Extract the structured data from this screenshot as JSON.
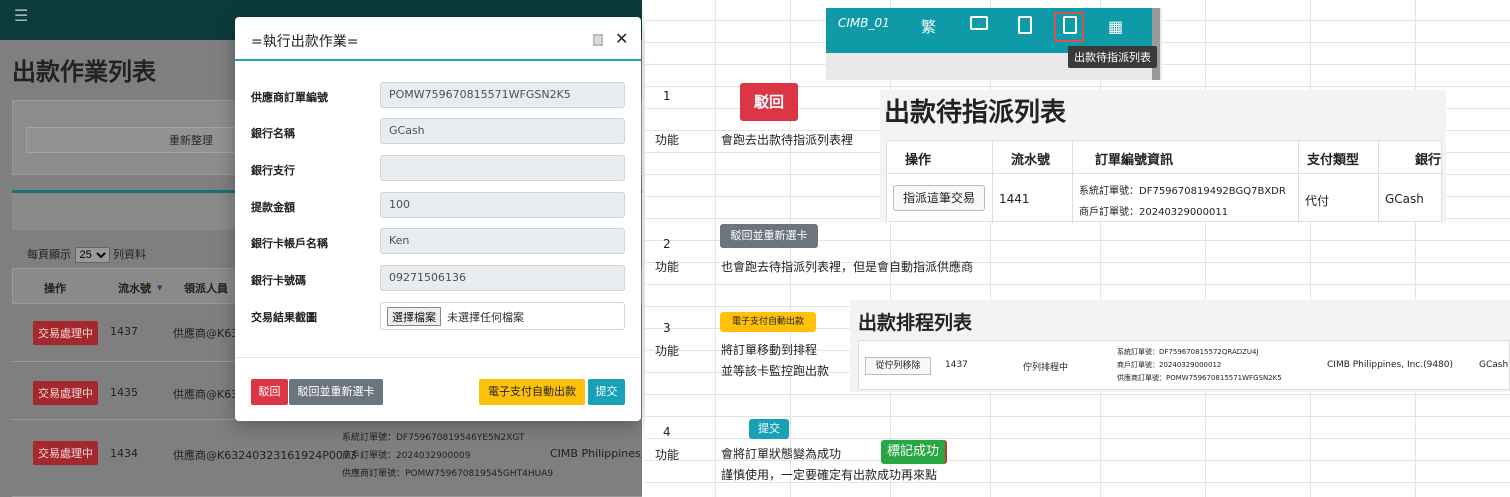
{
  "app": {
    "page_title": "出款作業列表",
    "refresh_label": "重新整理",
    "per_page_prefix": "每頁顯示",
    "per_page_value": "25",
    "per_page_suffix": "列資料",
    "table_headers": [
      "操作",
      "流水號",
      "領派人員"
    ],
    "rows": [
      {
        "status": "交易處理中",
        "id": "1437",
        "staff": "供應商@K63"
      },
      {
        "status": "交易處理中",
        "id": "1435",
        "staff": "供應商@K63"
      },
      {
        "status": "交易處理中",
        "id": "1434",
        "staff": "供應商@K63240323161924P0073",
        "order_sys": "系統訂單號：DF759670819546YE5N2XGT",
        "order_merchant": "商戶訂單號：2024032900009",
        "order_supplier": "供應商訂單號：POMW759670819545GHT4HUA9",
        "bank": "CIMB Philippines, In"
      }
    ]
  },
  "modal": {
    "title": "=執行出款作業=",
    "fields": [
      {
        "label": "供應商訂單編號",
        "value": "POMW759670815571WFGSN2K5"
      },
      {
        "label": "銀行名稱",
        "value": "GCash"
      },
      {
        "label": "銀行支行",
        "value": ""
      },
      {
        "label": "提款金額",
        "value": "100"
      },
      {
        "label": "銀行卡帳戶名稱",
        "value": "Ken"
      },
      {
        "label": "銀行卡號碼",
        "value": "09271506136"
      }
    ],
    "screenshot_label": "交易結果截圖",
    "file_button": "選擇檔案",
    "file_status": "未選擇任何檔案",
    "reject_label": "駁回",
    "reject_reselect_label": "駁回並重新選卡",
    "auto_payout_label": "電子支付自動出款",
    "submit_label": "提交"
  },
  "toolbar": {
    "brand": "CIMB_01",
    "lang": "繁",
    "tooltip": "出款待指派列表"
  },
  "doc": {
    "items": [
      {
        "num": "1",
        "func_label": "功能",
        "badge": "駁回",
        "desc": "會跑去出款待指派列表裡",
        "desc2": ""
      },
      {
        "num": "2",
        "func_label": "功能",
        "badge": "駁回並重新選卡",
        "desc": "也會跑去待指派列表裡，但是會自動指派供應商",
        "desc2": ""
      },
      {
        "num": "3",
        "func_label": "功能",
        "badge": "電子支付自動出款",
        "desc": "將訂單移動到排程",
        "desc2": "並等該卡監控跑出款"
      },
      {
        "num": "4",
        "func_label": "功能",
        "badge": "提交",
        "desc": "會將訂單狀態變為成功",
        "desc2": "謹慎使用，一定要確定有出款成功再來點"
      }
    ],
    "mark_success": "標記成功"
  },
  "list1": {
    "title": "出款待指派列表",
    "headers": [
      "操作",
      "流水號",
      "訂單編號資訊",
      "支付類型",
      "銀行"
    ],
    "row": {
      "action": "指派這筆交易",
      "id": "1441",
      "sys_order": "系統訂單號：DF759670819492BGQ7BXDR",
      "merchant_order": "商戶訂單號：20240329000011",
      "pay_type": "代付",
      "bank": "GCash"
    }
  },
  "list2": {
    "title": "出款排程列表",
    "row": {
      "action": "從佇列移除",
      "id": "1437",
      "status": "佇列排程中",
      "sys_order": "系統訂單號：DF759670815572QRADZU4J",
      "merchant_order": "商戶訂單號：20240329000012",
      "supplier_order": "供應商訂單號：POMW759670815571WFGSN2K5",
      "bank_name": "CIMB Philippines, Inc.(9480)",
      "bank": "GCash"
    }
  },
  "colors": {
    "danger": "#dc3545",
    "secondary": "#6c757d",
    "warning": "#ffc107",
    "info": "#17a2b8",
    "success": "#28a745",
    "teal": "#0e9aa7"
  }
}
